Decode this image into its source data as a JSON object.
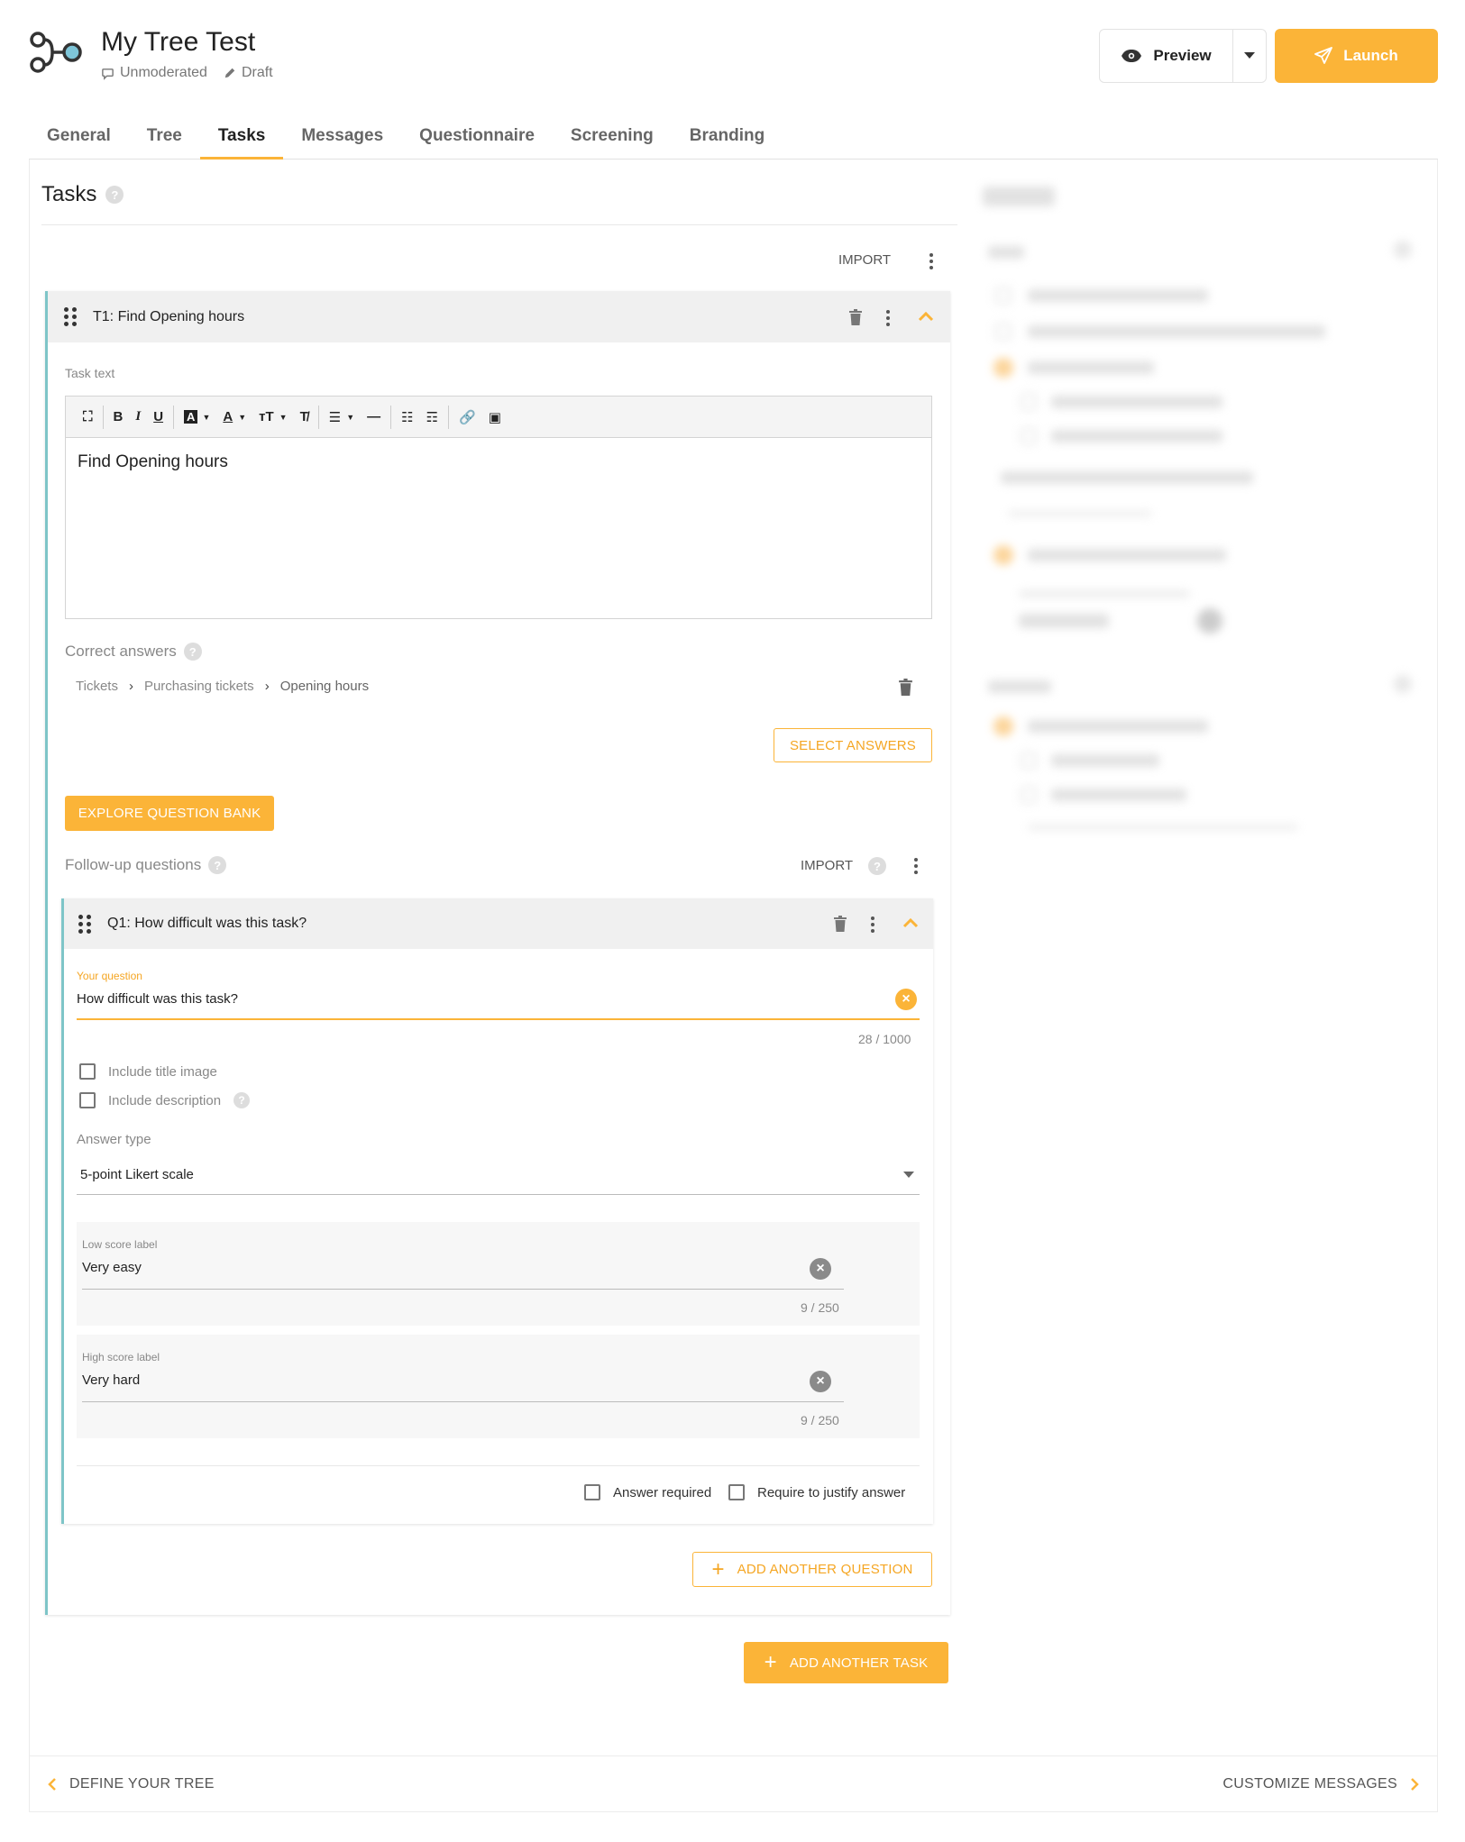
{
  "header": {
    "title": "My Tree Test",
    "mode": "Unmoderated",
    "status": "Draft",
    "preview_label": "Preview",
    "launch_label": "Launch",
    "accent_color": "#fbb438"
  },
  "tabs": [
    {
      "label": "General"
    },
    {
      "label": "Tree"
    },
    {
      "label": "Tasks",
      "active": true
    },
    {
      "label": "Messages"
    },
    {
      "label": "Questionnaire"
    },
    {
      "label": "Screening"
    },
    {
      "label": "Branding"
    }
  ],
  "tasks_panel": {
    "heading": "Tasks",
    "import_label": "IMPORT",
    "task": {
      "title": "T1: Find Opening hours",
      "task_text_label": "Task text",
      "task_text": "Find Opening hours",
      "correct_answers_label": "Correct answers",
      "answer_path": [
        "Tickets",
        "Purchasing tickets",
        "Opening hours"
      ],
      "select_answers_label": "SELECT ANSWERS",
      "explore_bank_label": "EXPLORE QUESTION BANK",
      "followup_label": "Follow-up questions",
      "followup_import_label": "IMPORT",
      "question": {
        "title": "Q1: How difficult was this task?",
        "your_question_label": "Your question",
        "question_value": "How difficult was this task?",
        "question_counter": "28 / 1000",
        "include_title_image": "Include title image",
        "include_description": "Include description",
        "answer_type_label": "Answer type",
        "answer_type_value": "5-point Likert scale",
        "low_label_caption": "Low score label",
        "low_label_value": "Very easy",
        "low_counter": "9 / 250",
        "high_label_caption": "High score label",
        "high_label_value": "Very hard",
        "high_counter": "9 / 250",
        "answer_required": "Answer required",
        "require_justify": "Require to justify answer"
      },
      "add_question_label": "ADD ANOTHER QUESTION"
    },
    "add_task_label": "ADD ANOTHER TASK"
  },
  "footer": {
    "prev_label": "DEFINE YOUR TREE",
    "next_label": "CUSTOMIZE MESSAGES"
  }
}
